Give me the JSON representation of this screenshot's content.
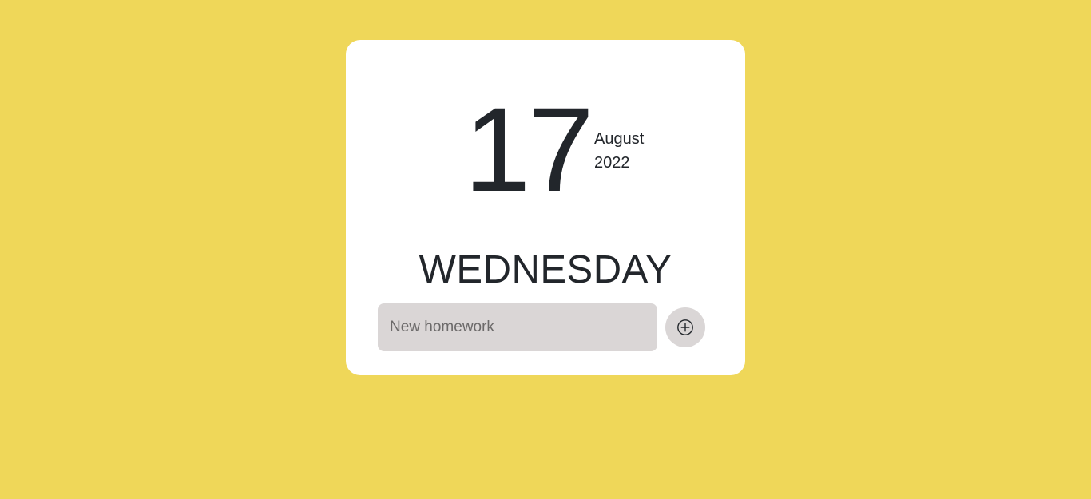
{
  "date": {
    "day": "17",
    "month": "August",
    "year": "2022",
    "weekday": "WEDNESDAY"
  },
  "homework": {
    "input_value": "",
    "placeholder": "New homework",
    "add_icon": "plus-circle-icon"
  },
  "colors": {
    "background": "#efd759",
    "card": "#ffffff",
    "text": "#22262b",
    "input": "#dad6d6"
  }
}
